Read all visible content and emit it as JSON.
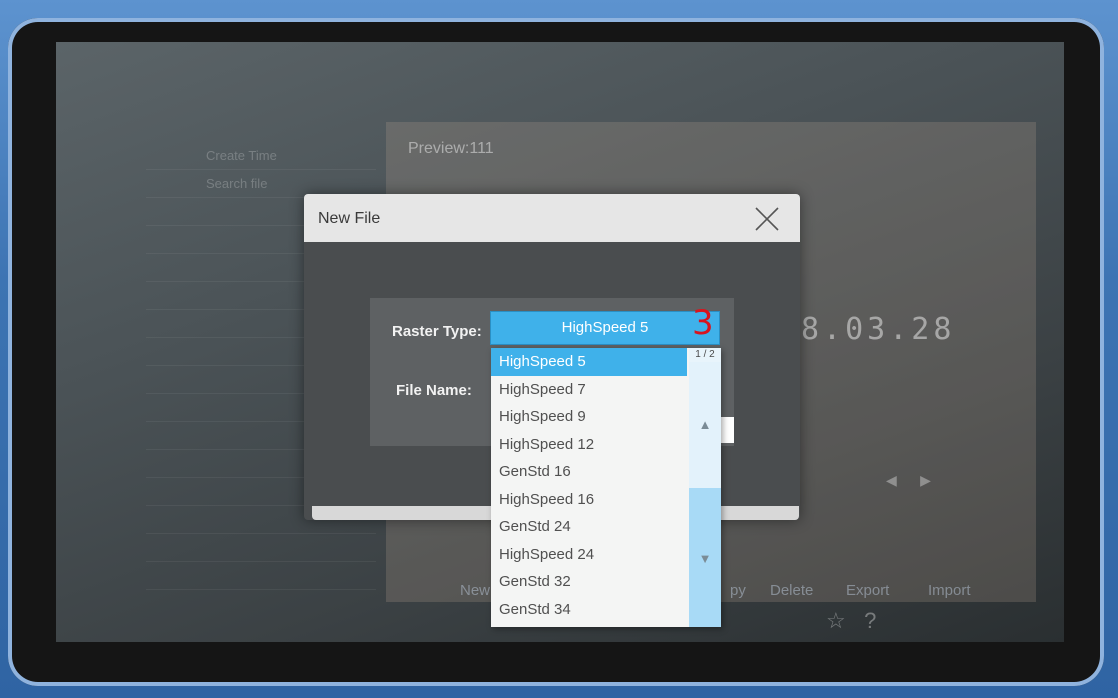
{
  "background": {
    "left_column_items": [
      "Create Time",
      "Search file"
    ],
    "preview_title": "Preview:111",
    "date_text": "8.03.28",
    "toolbar_labels": [
      "New",
      "py",
      "Delete",
      "Export",
      "Import"
    ],
    "footer_icons": [
      "star-icon",
      "help-icon"
    ]
  },
  "dialog": {
    "title": "New File",
    "raster_type_label": "Raster Type:",
    "raster_type_value": "HighSpeed 5",
    "file_name_label": "File Name:",
    "annotation": "3"
  },
  "dropdown": {
    "page_indicator": "1 / 2",
    "items": [
      "HighSpeed 5",
      "HighSpeed 7",
      "HighSpeed 9",
      "HighSpeed 12",
      "GenStd 16",
      "HighSpeed 16",
      "GenStd 24",
      "HighSpeed 24",
      "GenStd 32",
      "GenStd 34"
    ],
    "selected": "HighSpeed 5"
  },
  "colors": {
    "accent": "#3fb1ea",
    "annotation": "#d8141e",
    "bezel": "#3a78b8"
  }
}
